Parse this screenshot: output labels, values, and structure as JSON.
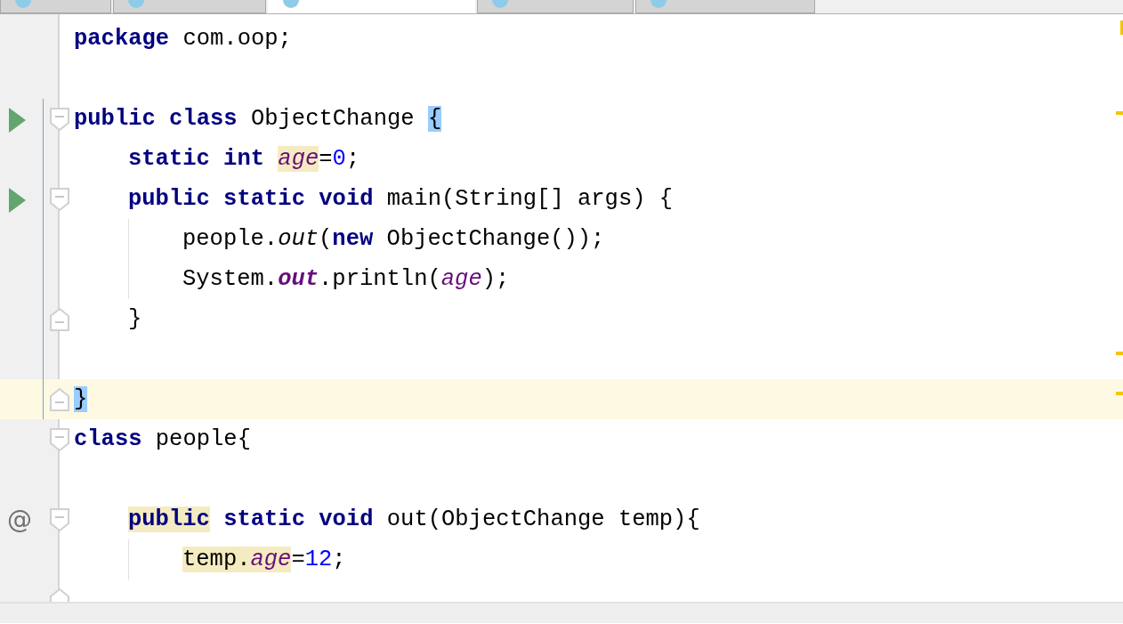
{
  "tabs": [
    {
      "selected": false
    },
    {
      "selected": false
    },
    {
      "selected": true
    },
    {
      "selected": false
    },
    {
      "selected": false
    }
  ],
  "lines": [
    {
      "tokens": [
        {
          "t": "package",
          "kind": "keyword"
        },
        {
          "t": " com.oop;",
          "kind": "plain"
        }
      ],
      "stripe_mark": true
    },
    {
      "blank_before": true,
      "run_icon": true,
      "fold_start": true,
      "scope_line": true,
      "stripe_mark": true,
      "tokens": [
        {
          "t": "public class",
          "kind": "keyword"
        },
        {
          "t": " ObjectChange ",
          "kind": "plain"
        },
        {
          "t": "{",
          "kind": "plain",
          "brace_match": true
        }
      ],
      "children": [
        {
          "scope_line": true,
          "tokens": [
            {
              "t": "static int ",
              "kind": "keyword"
            },
            {
              "t": "age",
              "kind": "field",
              "usage_highlight": true
            },
            {
              "t": "=",
              "kind": "plain"
            },
            {
              "t": "0",
              "kind": "number"
            },
            {
              "t": ";",
              "kind": "plain"
            }
          ]
        },
        {
          "run_icon": true,
          "fold_start": true,
          "scope_line": true,
          "tokens": [
            {
              "t": "public static void",
              "kind": "keyword"
            },
            {
              "t": " main(String[] args) {",
              "kind": "plain"
            }
          ],
          "children": [
            {
              "scope_line": true,
              "indent_guide": true,
              "tokens": [
                {
                  "t": "people.",
                  "kind": "plain"
                },
                {
                  "t": "out",
                  "kind": "static_method"
                },
                {
                  "t": "(",
                  "kind": "plain"
                },
                {
                  "t": "new",
                  "kind": "keyword"
                },
                {
                  "t": " ObjectChange());",
                  "kind": "plain"
                }
              ]
            },
            {
              "scope_line": true,
              "indent_guide": true,
              "tokens": [
                {
                  "t": "System.",
                  "kind": "plain"
                },
                {
                  "t": "out",
                  "kind": "static_field"
                },
                {
                  "t": ".println(",
                  "kind": "plain"
                },
                {
                  "t": "age",
                  "kind": "field"
                },
                {
                  "t": ");",
                  "kind": "plain"
                }
              ]
            }
          ]
        },
        {
          "fold_end": true,
          "scope_line": true,
          "tokens": [
            {
              "t": "}",
              "kind": "plain"
            }
          ]
        },
        {
          "scope_line": true,
          "stripe_mark": true
        }
      ]
    },
    {
      "fold_end": true,
      "scope_line": true,
      "current": true,
      "stripe_mark": true,
      "tokens": [
        {
          "t": "}",
          "kind": "plain",
          "brace_match": true
        }
      ]
    },
    {
      "fold_start": true,
      "tokens": [
        {
          "t": "class",
          "kind": "keyword"
        },
        {
          "t": " people{",
          "kind": "plain"
        }
      ],
      "children": [
        {
          "blank_before": true,
          "gutter_glyph": "@",
          "fold_start": true,
          "tokens": [
            {
              "t": "public",
              "kind": "keyword",
              "usage_highlight": true
            },
            {
              "t": " static void",
              "kind": "keyword"
            },
            {
              "t": " out(ObjectChange temp){",
              "kind": "plain"
            }
          ],
          "children": [
            {
              "indent_guide": true,
              "tokens": [
                {
                  "t": "temp.",
                  "kind": "plain",
                  "usage_highlight": true
                },
                {
                  "t": "age",
                  "kind": "field",
                  "usage_highlight": true
                },
                {
                  "t": "=",
                  "kind": "plain"
                },
                {
                  "t": "12",
                  "kind": "number"
                },
                {
                  "t": ";",
                  "kind": "plain"
                }
              ]
            }
          ]
        }
      ]
    },
    {
      "fold_end": true
    }
  ]
}
